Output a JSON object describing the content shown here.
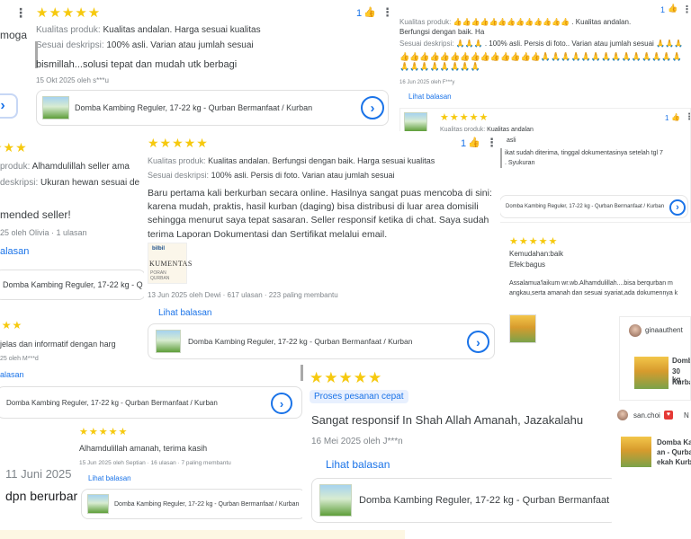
{
  "colors": {
    "star": "#f6c90e",
    "link": "#1a73e8",
    "label": "#80868b",
    "text": "#3c4043"
  },
  "common": {
    "stars": "★★★★★",
    "more_icon": "⋮",
    "thumbs_icon": "👍",
    "arrow_icon": "›"
  },
  "frag_top_left": {
    "text": "moga"
  },
  "card_top": {
    "like_count": "1",
    "quality_label": "Kualitas produk:",
    "quality_value": "Kualitas andalan. Harga sesuai kualitas",
    "desc_label": "Sesuai deskripsi:",
    "desc_value": "100% asli. Varian atau jumlah sesuai",
    "body": "bismillah...solusi tepat dan mudah utk berbagi",
    "meta": "15 Okt 2025 oleh s***u",
    "product": "Domba Kambing Reguler, 17-22 kg - Qurban Bermanfaat / Kurban"
  },
  "card_top_right": {
    "like_count": "1",
    "quality_label": "Kualitas produk:",
    "quality_value": ". Kualitas andalan.",
    "quality_value_2": "Berfungsi dengan baik. Ha",
    "desc_label": "Sesuai deskripsi:",
    "desc_value": ". 100% asli. Persis di foto.. Varian atau jumlah sesuai",
    "meta": "16 Jun 2025 oleh F***y",
    "reply_link": "Lihat balasan"
  },
  "card_left_mid": {
    "quality_label": "produk:",
    "quality_value": "Alhamdulillah seller ama",
    "desc_label": "deskripsi:",
    "desc_value": "Ukuran hewan sesuai de",
    "body": "mended seller!",
    "meta": "25 oleh Olivia · 1 ulasan",
    "reply_link": "alasan",
    "product": "Domba Kambing Reguler, 17-22 kg - Q"
  },
  "card_center": {
    "like_count": "1",
    "quality_label": "Kualitas produk:",
    "quality_value": "Kualitas andalan. Berfungsi dengan baik. Harga sesuai kualitas",
    "desc_label": "Sesuai deskripsi:",
    "desc_value": "100% asli. Persis di foto. Varian atau jumlah sesuai",
    "body": "Baru pertama kali berkurban secara online. Hasilnya sangat puas mencoba di sini: karena mudah, praktis, hasil kurban (daging) bisa distribusi di luar area domisili sehingga menurut saya tepat sasaran. Seller responsif ketika di chat. Saya sudah terima Laporan Dokumentasi dan Sertifikat melalui email.",
    "doc_logo": "bilbil",
    "doc_title": "KUMENTAS",
    "doc_sub": "PORAN QURBAN",
    "meta": "13 Jun 2025 oleh Dewi · 617 ulasan · 223 paling membantu",
    "reply_link": "Lihat balasan",
    "product": "Domba Kambing Reguler, 17-22 kg - Qurban Bermanfaat / Kurban"
  },
  "card_right_mid": {
    "like_count": "1",
    "quality_label": "Kualitas produk:",
    "quality_value": "Kualitas andalan",
    "desc_value": "asli",
    "body": "ikat sudah diterima, tinggal dokumentasinya setelah tgl 7",
    "body_2": ". Syukuran",
    "product": "Domba Kambing Reguler, 17-22 kg - Qurban Bermanfaat / Kurban"
  },
  "card_right_lower": {
    "line1": "Kemudahan:baik",
    "line2": "Efek:bagus",
    "body": "Assalamua'laikum wr.wb.Alhamdulillah....bisa berqurban m angkau,serta amanah dan sesuai syariat,ada dokumennya k"
  },
  "card_left_lower": {
    "body": "jelas dan informatif dengan harg",
    "meta": "25 oleh M***d",
    "reply_link": "alasan",
    "product": "Domba Kambing Reguler, 17-22 kg - Qurban Bermanfaat / Kurban"
  },
  "card_chip": {
    "chip": "Proses pesanan cepat",
    "body": "Sangat responsif In Shah Allah Amanah, Jazakalahu",
    "meta": "16 Mei 2025 oleh J***n",
    "reply_link": "Lihat balasan",
    "product": "Domba Kambing Reguler, 17-22 kg - Qurban Bermanfaat /"
  },
  "card_small": {
    "body": "Alhamdulillah amanah, terima kasih",
    "meta": "15 Jun 2025 oleh Septian · 16 ulasan · 7 paling membantu",
    "reply_link": "Lihat balasan",
    "product": "Domba Kambing Reguler, 17-22 kg - Qurban Bermanfaat / Kurban"
  },
  "frag_bottom_left": {
    "date": "11 Juni 2025",
    "text": "dpn berurbar"
  },
  "social_1": {
    "user": "ginaauthent",
    "title": "Domb",
    "sub": "30 kg",
    "sub2": "Kurba"
  },
  "social_2": {
    "user": "san.choi",
    "user_extra": "N",
    "title": "Domba Ka",
    "sub": "an - Qurba",
    "sub2": "ekah Kurba"
  }
}
